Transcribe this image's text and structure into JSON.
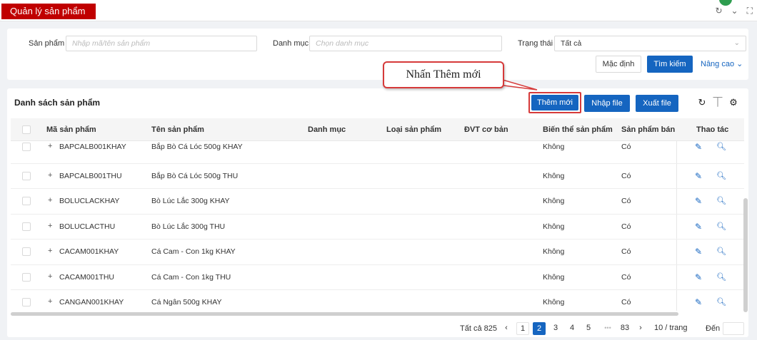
{
  "header": {
    "title": "Quản lý sản phẩm"
  },
  "filters": {
    "product_label": "Sản phẩm",
    "product_placeholder": "Nhập mã/tên sản phẩm",
    "category_label": "Danh mục",
    "category_placeholder": "Chọn danh mục",
    "status_label": "Trạng thái",
    "status_value": "Tất cả",
    "default_label": "Mặc định",
    "search_label": "Tìm kiếm",
    "advanced_label": "Nâng cao"
  },
  "callout": {
    "text": "Nhấn Thêm mới"
  },
  "list": {
    "title": "Danh sách sản phẩm",
    "add_label": "Thêm mới",
    "import_label": "Nhập file",
    "export_label": "Xuất file"
  },
  "table": {
    "columns": [
      "Mã sản phẩm",
      "Tên sản phẩm",
      "Danh mục",
      "Loại sản phẩm",
      "ĐVT cơ bản",
      "Biến thể sản phẩm",
      "Sản phẩm bán",
      "Thao tác"
    ],
    "rows": [
      {
        "code": "BAPCALB001KHAY",
        "name": "Bắp Bò Cá Lóc 500g KHAY",
        "variant": "Không",
        "sellable": "Có"
      },
      {
        "code": "BAPCALB001THU",
        "name": "Bắp Bò Cá Lóc 500g THU",
        "variant": "Không",
        "sellable": "Có"
      },
      {
        "code": "BOLUCLACKHAY",
        "name": "Bò Lúc Lắc 300g KHAY",
        "variant": "Không",
        "sellable": "Có"
      },
      {
        "code": "BOLUCLACTHU",
        "name": "Bò Lúc Lắc 300g THU",
        "variant": "Không",
        "sellable": "Có"
      },
      {
        "code": "CACAM001KHAY",
        "name": "Cá Cam - Con 1kg KHAY",
        "variant": "Không",
        "sellable": "Có"
      },
      {
        "code": "CACAM001THU",
        "name": "Cá Cam - Con 1kg THU",
        "variant": "Không",
        "sellable": "Có"
      },
      {
        "code": "CANGAN001KHAY",
        "name": "Cá Ngân 500g KHAY",
        "variant": "Không",
        "sellable": "Có"
      }
    ]
  },
  "pagination": {
    "total_label": "Tất cả 825",
    "pages": [
      "1",
      "2",
      "3",
      "4",
      "5"
    ],
    "active_page": "2",
    "ellipsis": "•••",
    "last_page": "83",
    "page_size": "10 / trang",
    "goto_label": "Đến"
  },
  "colors": {
    "brand_red": "#c00000",
    "primary": "#1565c0",
    "highlight": "#d63a3a"
  }
}
